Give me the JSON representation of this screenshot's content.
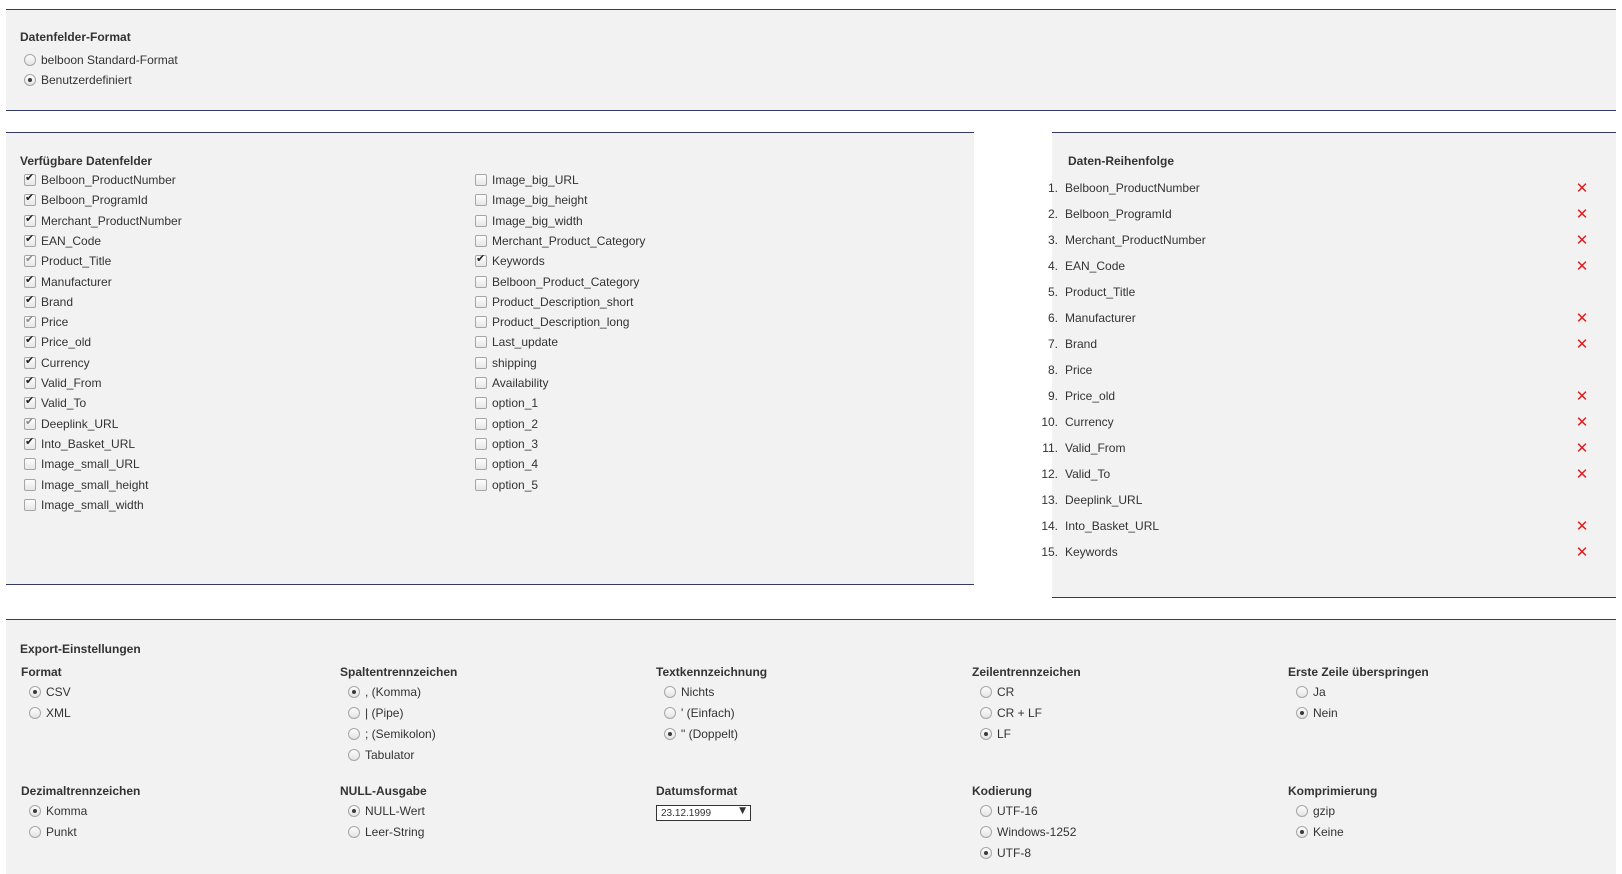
{
  "datenfelder_format": {
    "title": "Datenfelder-Format",
    "options": [
      {
        "label": "belboon Standard-Format",
        "checked": false
      },
      {
        "label": "Benutzerdefiniert",
        "checked": true
      }
    ]
  },
  "available_fields": {
    "title": "Verfügbare Datenfelder",
    "column1": [
      {
        "label": "Belboon_ProductNumber",
        "checked": true,
        "disabled": false
      },
      {
        "label": "Belboon_ProgramId",
        "checked": true,
        "disabled": false
      },
      {
        "label": "Merchant_ProductNumber",
        "checked": true,
        "disabled": false
      },
      {
        "label": "EAN_Code",
        "checked": true,
        "disabled": false
      },
      {
        "label": "Product_Title",
        "checked": true,
        "disabled": true
      },
      {
        "label": "Manufacturer",
        "checked": true,
        "disabled": false
      },
      {
        "label": "Brand",
        "checked": true,
        "disabled": false
      },
      {
        "label": "Price",
        "checked": true,
        "disabled": true
      },
      {
        "label": "Price_old",
        "checked": true,
        "disabled": false
      },
      {
        "label": "Currency",
        "checked": true,
        "disabled": false
      },
      {
        "label": "Valid_From",
        "checked": true,
        "disabled": false
      },
      {
        "label": "Valid_To",
        "checked": true,
        "disabled": false
      },
      {
        "label": "Deeplink_URL",
        "checked": true,
        "disabled": true
      },
      {
        "label": "Into_Basket_URL",
        "checked": true,
        "disabled": false
      },
      {
        "label": "Image_small_URL",
        "checked": false,
        "disabled": false
      },
      {
        "label": "Image_small_height",
        "checked": false,
        "disabled": false
      },
      {
        "label": "Image_small_width",
        "checked": false,
        "disabled": false
      }
    ],
    "column2": [
      {
        "label": "Image_big_URL",
        "checked": false,
        "disabled": false
      },
      {
        "label": "Image_big_height",
        "checked": false,
        "disabled": false
      },
      {
        "label": "Image_big_width",
        "checked": false,
        "disabled": false
      },
      {
        "label": "Merchant_Product_Category",
        "checked": false,
        "disabled": false
      },
      {
        "label": "Keywords",
        "checked": true,
        "disabled": false
      },
      {
        "label": "Belboon_Product_Category",
        "checked": false,
        "disabled": false
      },
      {
        "label": "Product_Description_short",
        "checked": false,
        "disabled": false
      },
      {
        "label": "Product_Description_long",
        "checked": false,
        "disabled": false
      },
      {
        "label": "Last_update",
        "checked": false,
        "disabled": false
      },
      {
        "label": "shipping",
        "checked": false,
        "disabled": false
      },
      {
        "label": "Availability",
        "checked": false,
        "disabled": false
      },
      {
        "label": "option_1",
        "checked": false,
        "disabled": false
      },
      {
        "label": "option_2",
        "checked": false,
        "disabled": false
      },
      {
        "label": "option_3",
        "checked": false,
        "disabled": false
      },
      {
        "label": "option_4",
        "checked": false,
        "disabled": false
      },
      {
        "label": "option_5",
        "checked": false,
        "disabled": false
      }
    ]
  },
  "order": {
    "title": "Daten-Reihenfolge",
    "items": [
      {
        "num": "1.",
        "name": "Belboon_ProductNumber",
        "removable": true
      },
      {
        "num": "2.",
        "name": "Belboon_ProgramId",
        "removable": true
      },
      {
        "num": "3.",
        "name": "Merchant_ProductNumber",
        "removable": true
      },
      {
        "num": "4.",
        "name": "EAN_Code",
        "removable": true
      },
      {
        "num": "5.",
        "name": "Product_Title",
        "removable": false
      },
      {
        "num": "6.",
        "name": "Manufacturer",
        "removable": true
      },
      {
        "num": "7.",
        "name": "Brand",
        "removable": true
      },
      {
        "num": "8.",
        "name": "Price",
        "removable": false
      },
      {
        "num": "9.",
        "name": "Price_old",
        "removable": true
      },
      {
        "num": "10.",
        "name": "Currency",
        "removable": true
      },
      {
        "num": "11.",
        "name": "Valid_From",
        "removable": true
      },
      {
        "num": "12.",
        "name": "Valid_To",
        "removable": true
      },
      {
        "num": "13.",
        "name": "Deeplink_URL",
        "removable": false
      },
      {
        "num": "14.",
        "name": "Into_Basket_URL",
        "removable": true
      },
      {
        "num": "15.",
        "name": "Keywords",
        "removable": true
      }
    ],
    "remove_glyph": "✕"
  },
  "export": {
    "title": "Export-Einstellungen",
    "format": {
      "title": "Format",
      "options": [
        {
          "label": "CSV",
          "checked": true
        },
        {
          "label": "XML",
          "checked": false
        }
      ]
    },
    "spalten": {
      "title": "Spaltentrennzeichen",
      "options": [
        {
          "label": ", (Komma)",
          "checked": true
        },
        {
          "label": "| (Pipe)",
          "checked": false
        },
        {
          "label": "; (Semikolon)",
          "checked": false
        },
        {
          "label": "Tabulator",
          "checked": false
        }
      ]
    },
    "text": {
      "title": "Textkennzeichnung",
      "options": [
        {
          "label": "Nichts",
          "checked": false
        },
        {
          "label": "' (Einfach)",
          "checked": false
        },
        {
          "label": "\" (Doppelt)",
          "checked": true
        }
      ]
    },
    "zeilen": {
      "title": "Zeilentrennzeichen",
      "options": [
        {
          "label": "CR",
          "checked": false
        },
        {
          "label": "CR + LF",
          "checked": false
        },
        {
          "label": "LF",
          "checked": true
        }
      ]
    },
    "erste": {
      "title": "Erste Zeile überspringen",
      "options": [
        {
          "label": "Ja",
          "checked": false
        },
        {
          "label": "Nein",
          "checked": true
        }
      ]
    },
    "dezimal": {
      "title": "Dezimaltrennzeichen",
      "options": [
        {
          "label": "Komma",
          "checked": true
        },
        {
          "label": "Punkt",
          "checked": false
        }
      ]
    },
    "null": {
      "title": "NULL-Ausgabe",
      "options": [
        {
          "label": "NULL-Wert",
          "checked": true
        },
        {
          "label": "Leer-String",
          "checked": false
        }
      ]
    },
    "datum": {
      "title": "Datumsformat",
      "value": "23.12.1999",
      "arrow": "▼"
    },
    "kodierung": {
      "title": "Kodierung",
      "options": [
        {
          "label": "UTF-16",
          "checked": false
        },
        {
          "label": "Windows-1252",
          "checked": false
        },
        {
          "label": "UTF-8",
          "checked": true
        }
      ]
    },
    "komp": {
      "title": "Komprimierung",
      "options": [
        {
          "label": "gzip",
          "checked": false
        },
        {
          "label": "Keine",
          "checked": true
        }
      ]
    }
  }
}
